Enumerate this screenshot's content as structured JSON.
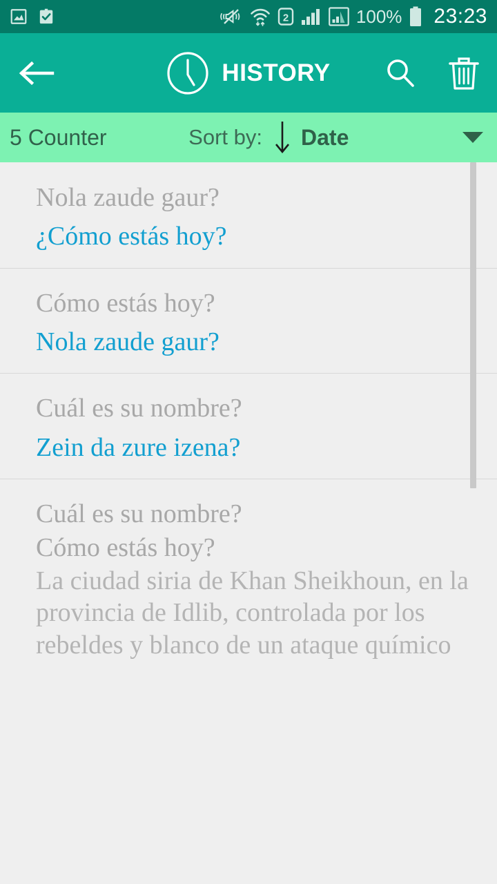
{
  "status_bar": {
    "icons_left": [
      "gallery-icon",
      "clipboard-check-icon"
    ],
    "icons_right": [
      "mute-vibrate-icon",
      "wifi-icon",
      "sim2-icon",
      "signal-bars-icon",
      "signal-bars-2-icon"
    ],
    "battery_percent": "100%",
    "battery_icon": "battery-full-icon",
    "time": "23:23",
    "background_color": "#047a66"
  },
  "app_bar": {
    "back_icon": "back-arrow-icon",
    "clock_icon": "clock-icon",
    "title": "HISTORY",
    "search_icon": "search-icon",
    "delete_icon": "trash-icon",
    "background_color": "#0aaf96"
  },
  "sort_bar": {
    "counter": "5 Counter",
    "sort_label": "Sort by:",
    "direction_icon": "arrow-down-icon",
    "sort_value": "Date",
    "dropdown_icon": "caret-down-icon",
    "background_color": "#7df2b2"
  },
  "history": {
    "source_color": "#a8a8a8",
    "translation_color": "#129fd0",
    "items": [
      {
        "source": "Nola zaude gaur?",
        "translation": "¿Cómo estás hoy?"
      },
      {
        "source": "Cómo estás hoy?",
        "translation": "Nola zaude gaur?"
      },
      {
        "source": "Cuál es su nombre?",
        "translation": "Zein da zure izena?"
      },
      {
        "source": "Cuál es su nombre?",
        "source_line2": "Cómo estás hoy?",
        "body": "La ciudad siria de Khan Sheikhoun, en la provincia de Idlib, controlada por los rebeldes y blanco de un ataque químico que propició un ataque de"
      }
    ]
  },
  "scrollbar": {
    "name": "vertical-scrollbar"
  }
}
